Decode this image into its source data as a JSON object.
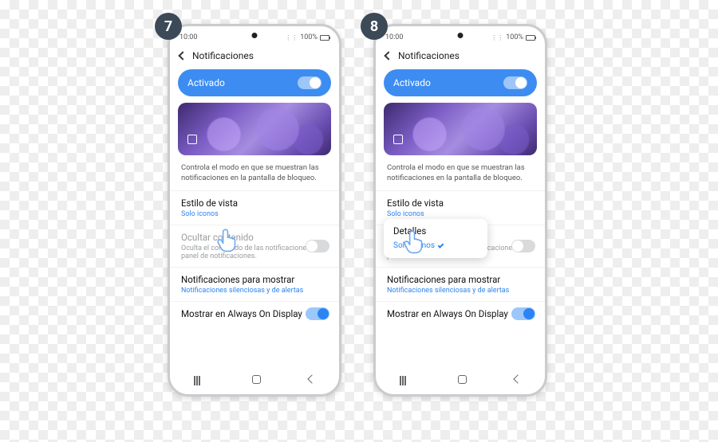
{
  "badges": {
    "left": "7",
    "right": "8"
  },
  "status": {
    "time": "10:00",
    "battery": "100%"
  },
  "header": {
    "title": "Notificaciones"
  },
  "pill": {
    "label": "Activado"
  },
  "description": "Controla el modo en que se muestran las notificaciones en la pantalla de bloqueo.",
  "rows": {
    "viewStyle": {
      "title": "Estilo de vista",
      "sub": "Solo iconos"
    },
    "hideContent": {
      "title": "Ocultar contenido",
      "sub": "Oculta el contenido de las notificaciones en el panel de notificaciones."
    },
    "toShow": {
      "title": "Notificaciones para mostrar",
      "sub": "Notificaciones silenciosas y de alertas"
    },
    "aod": {
      "title": "Mostrar en Always On Display"
    }
  },
  "popup": {
    "title": "Detalles",
    "option": "Solo iconos"
  }
}
